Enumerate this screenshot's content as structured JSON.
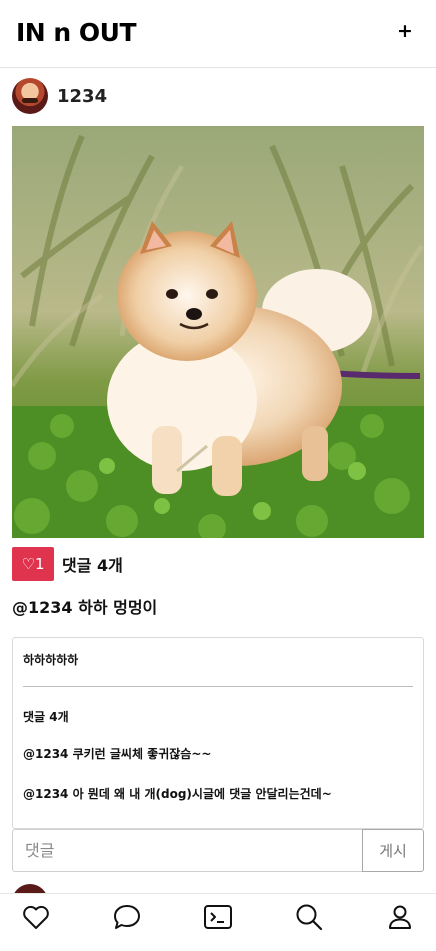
{
  "header": {
    "brand": "IN n OUT",
    "add_label": "+"
  },
  "post": {
    "author": "1234",
    "photo": {
      "subject": "pomeranian-dog-on-grass"
    },
    "like_label": "♡1",
    "comment_count_label": "댓글 4개",
    "caption": "@1234 하하 멍멍이"
  },
  "comments_panel": {
    "description": "하하하하하",
    "title": "댓글 4개",
    "items": [
      "@1234 쿠키런 글씨체 좋귀잖슴~~",
      "@1234 아 뭔데 왜 내 개(dog)시글에 댓글 안달리는건데~"
    ]
  },
  "comment_form": {
    "placeholder": "댓글",
    "value": "",
    "submit_label": "게시"
  },
  "bottom_nav": {
    "items": [
      {
        "icon": "heart-icon"
      },
      {
        "icon": "chat-bubble-icon"
      },
      {
        "icon": "terminal-icon"
      },
      {
        "icon": "search-icon"
      },
      {
        "icon": "user-icon"
      }
    ]
  },
  "colors": {
    "like_button": "#e0344e",
    "border": "#d9d9d9",
    "text": "#111111"
  }
}
